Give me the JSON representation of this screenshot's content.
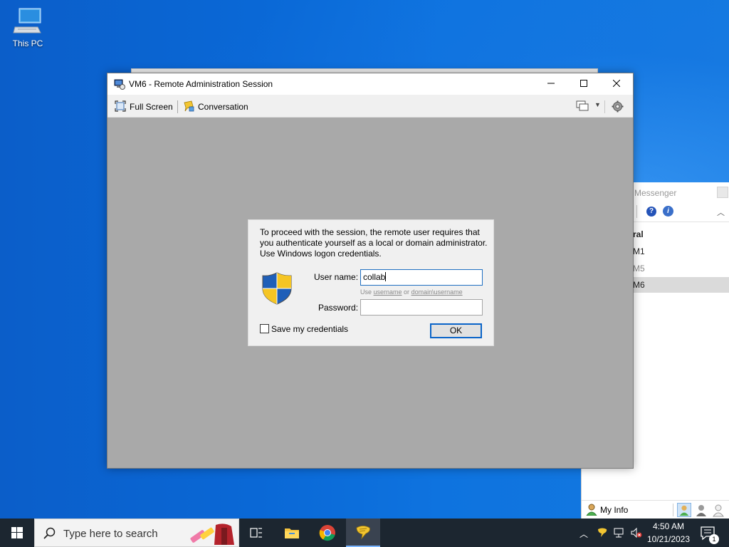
{
  "desktop": {
    "icons": [
      {
        "label": "This PC",
        "icon": "computer-icon"
      }
    ]
  },
  "messenger": {
    "title": "Messenger",
    "group_label": "ral",
    "contacts": [
      "M1",
      "M5",
      "M6"
    ],
    "selected_contact": "M6",
    "footer": {
      "my_info_label": "My Info"
    }
  },
  "main_window": {
    "title": "VM6 - Remote Administration Session",
    "toolbar": {
      "full_screen_label": "Full Screen",
      "conversation_label": "Conversation"
    }
  },
  "auth_dialog": {
    "message": "To proceed with the session, the remote user requires that you authenticate yourself as a local or domain administrator. Use Windows logon credentials.",
    "user_name_label": "User name:",
    "user_name_value": "collab",
    "hint_prefix": "Use ",
    "hint_username": "username",
    "hint_or": " or ",
    "hint_domain_username": "domain\\username",
    "password_label": "Password:",
    "password_value": "",
    "save_credentials_label": "Save my credentials",
    "save_credentials_checked": false,
    "ok_label": "OK"
  },
  "taskbar": {
    "search_placeholder": "Type here to search",
    "clock_time": "4:50 AM",
    "clock_date": "10/21/2023",
    "notification_count": "1"
  },
  "colors": {
    "desktop": "#0a68d6",
    "session_bg": "#a9a9a9",
    "accent": "#0a64c8",
    "taskbar": "#1c2630"
  }
}
